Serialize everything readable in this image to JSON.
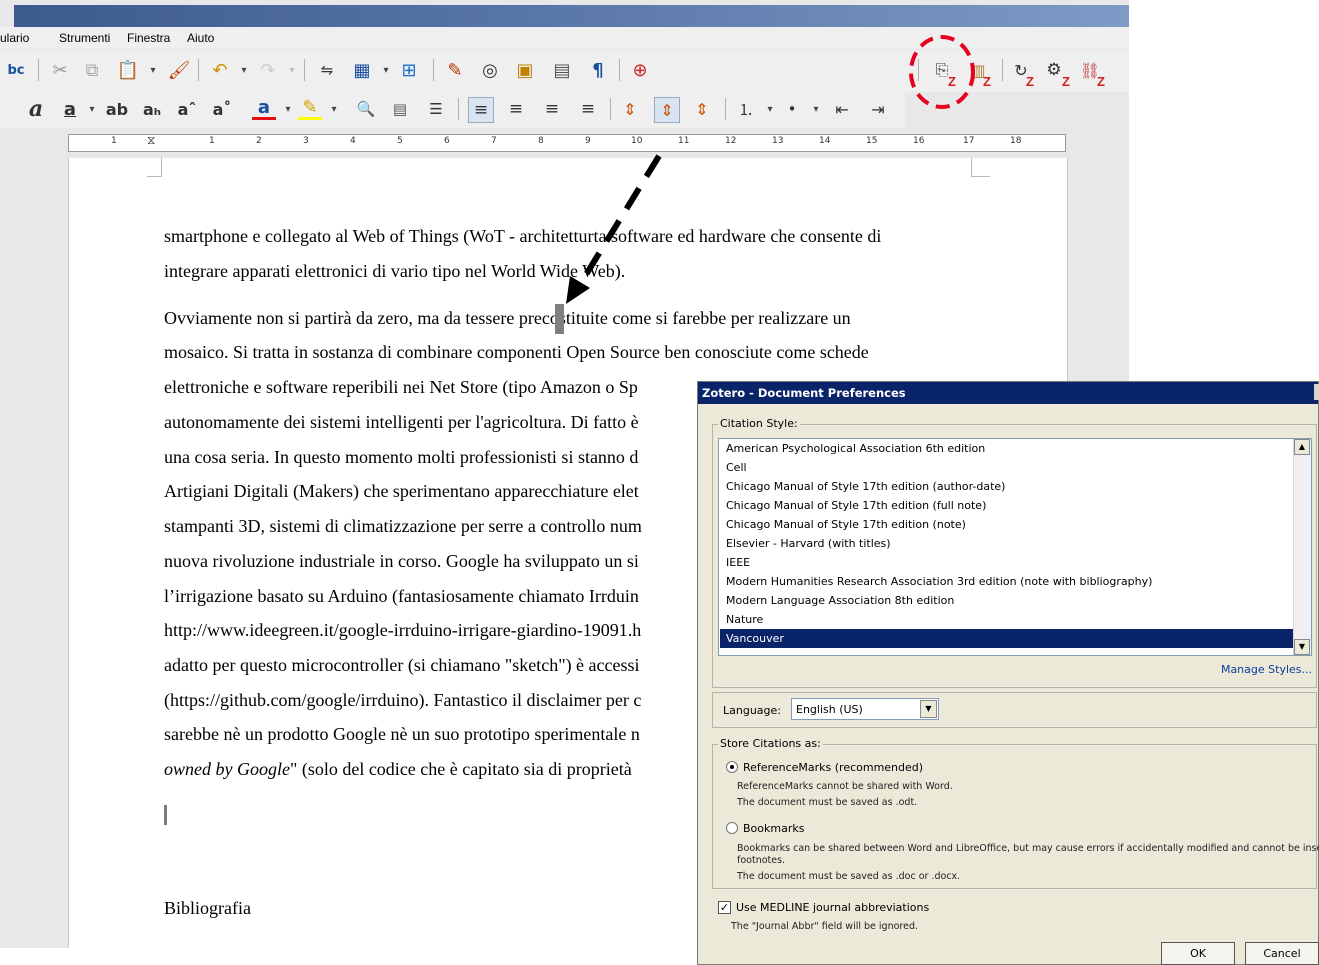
{
  "menubar": {
    "items": [
      "ulario",
      "Strumenti",
      "Finestra",
      "Aiuto"
    ]
  },
  "ruler": {
    "numbers": [
      "1",
      "1",
      "2",
      "3",
      "4",
      "5",
      "6",
      "7",
      "8",
      "9",
      "10",
      "11",
      "12",
      "13",
      "14",
      "15",
      "16",
      "17",
      "18"
    ]
  },
  "toolbar": {
    "zotero_marker": "Z"
  },
  "document": {
    "lines": [
      "smartphone e collegato al Web of Things (WoT - architetturta software ed hardware che consente di",
      "integrare apparati elettronici di vario tipo  nel World Wide Web).",
      "Ovviamente non si partirà da zero, ma da tessere precostituite come si farebbe per realizzare un",
      "mosaico. Si tratta in sostanza di combinare componenti Open Source ben conosciute come schede",
      "elettroniche e software reperibili nei Net Store (tipo Amazon o Sp",
      "autonomamente dei sistemi intelligenti per l'agricoltura. Di fatto è",
      "una cosa seria. In questo momento molti professionisti si stanno d",
      "Artigiani Digitali (Makers) che sperimentano apparecchiature elet",
      "stampanti 3D, sistemi di climatizzazione per serre a controllo num",
      "nuova rivoluzione industriale in corso. Google ha sviluppato un si",
      "l’irrigazione basato su Arduino (fantasiosamente chiamato Irrduin",
      "http://www.ideegreen.it/google-irrduino-irrigare-giardino-19091.h",
      "adatto per questo microcontroller (si chiamano \"sketch\") è accessi",
      "(https://github.com/google/irrduino). Fantastico il disclaimer per c",
      "sarebbe nè un prodotto Google nè un suo prototipo sperimentale n"
    ],
    "italic_prefix": "owned by Google",
    "last_line_rest": "\" (solo del  codice che è capitato sia di proprietà",
    "heading": "Bibliografia"
  },
  "dialog": {
    "title": "Zotero - Document Preferences",
    "citation_style_label": "Citation Style:",
    "styles": [
      "American Psychological Association 6th edition",
      "Cell",
      "Chicago Manual of Style 17th edition (author-date)",
      "Chicago Manual of Style 17th edition (full note)",
      "Chicago Manual of Style 17th edition (note)",
      "Elsevier - Harvard (with titles)",
      "IEEE",
      "Modern Humanities Research Association 3rd edition (note with bibliography)",
      "Modern Language Association 8th edition",
      "Nature",
      "Vancouver"
    ],
    "selected_style": "Vancouver",
    "manage_styles": "Manage Styles...",
    "language_label": "Language:",
    "language_value": "English (US)",
    "store_label": "Store Citations as:",
    "reference_marks_label": "ReferenceMarks (recommended)",
    "reference_marks_note1": "ReferenceMarks cannot be shared with Word.",
    "reference_marks_note2": "The document must be saved as .odt.",
    "bookmarks_label": "Bookmarks",
    "bookmarks_note1": "Bookmarks can be shared between Word and LibreOffice, but may cause errors if accidentally modified and cannot be inserted into",
    "bookmarks_note1b": "footnotes.",
    "bookmarks_note2": "The document must be saved as .doc or .docx.",
    "medline_label": "Use MEDLINE journal abbreviations",
    "medline_note": "The \"Journal Abbr\" field will be ignored.",
    "ok_label": "OK",
    "cancel_label": "Cancel",
    "reference_marks_checked": true,
    "medline_checked": true
  },
  "colors": {
    "title_blue": "#0a246a",
    "annotation_red": "#e8001c",
    "selection": "#0a246a"
  }
}
